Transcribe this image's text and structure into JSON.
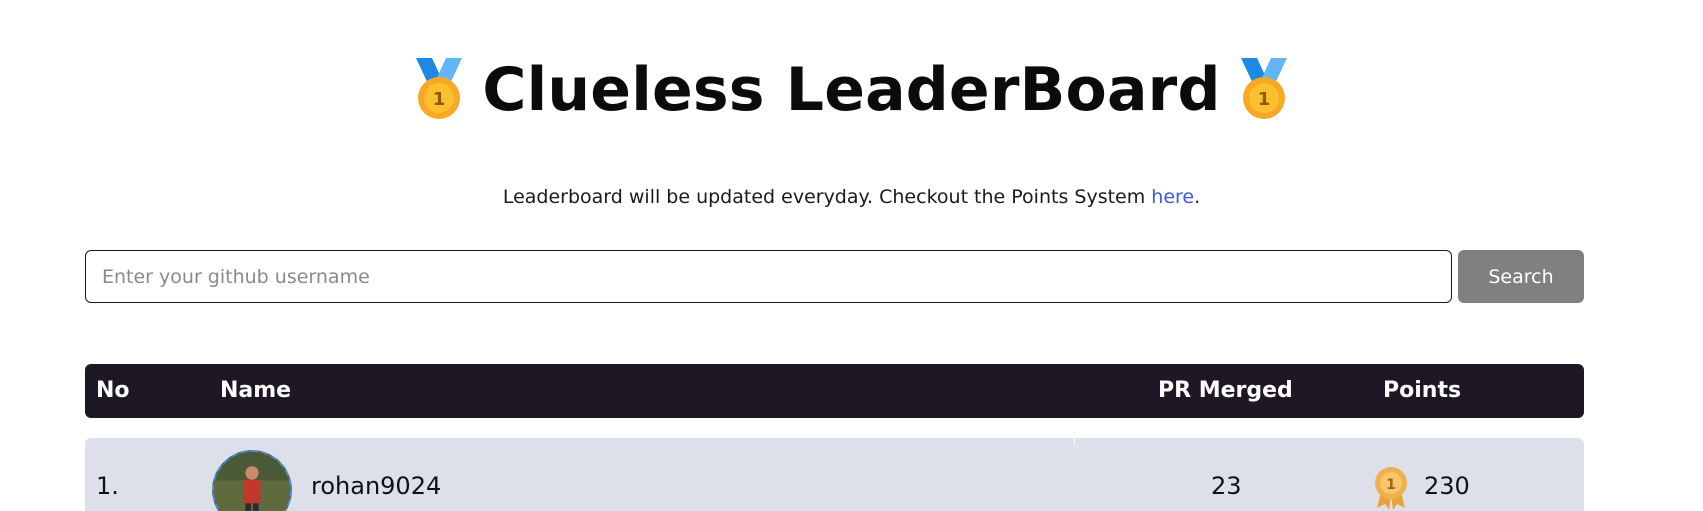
{
  "header": {
    "title": "Clueless LeaderBoard",
    "left_icon": "gold-medal-icon",
    "right_icon": "gold-medal-icon"
  },
  "subtitle": {
    "text": "Leaderboard will be updated everyday. Checkout the Points System ",
    "link_text": "here",
    "suffix": "."
  },
  "search": {
    "placeholder": "Enter your github username",
    "value": "",
    "button_label": "Search"
  },
  "table": {
    "columns": [
      "No",
      "Name",
      "PR Merged",
      "Points"
    ],
    "rows": [
      {
        "no": "1.",
        "name": "rohan9024",
        "avatar": "user-avatar",
        "pr_merged": "23",
        "points_icon": "first-place-badge-icon",
        "points": "230"
      }
    ]
  },
  "colors": {
    "header_bg": "#1e1724",
    "row_bg": "#dde0ea",
    "button_bg": "#808080",
    "link": "#3b5bdb",
    "avatar_border": "#3f8cf0"
  }
}
